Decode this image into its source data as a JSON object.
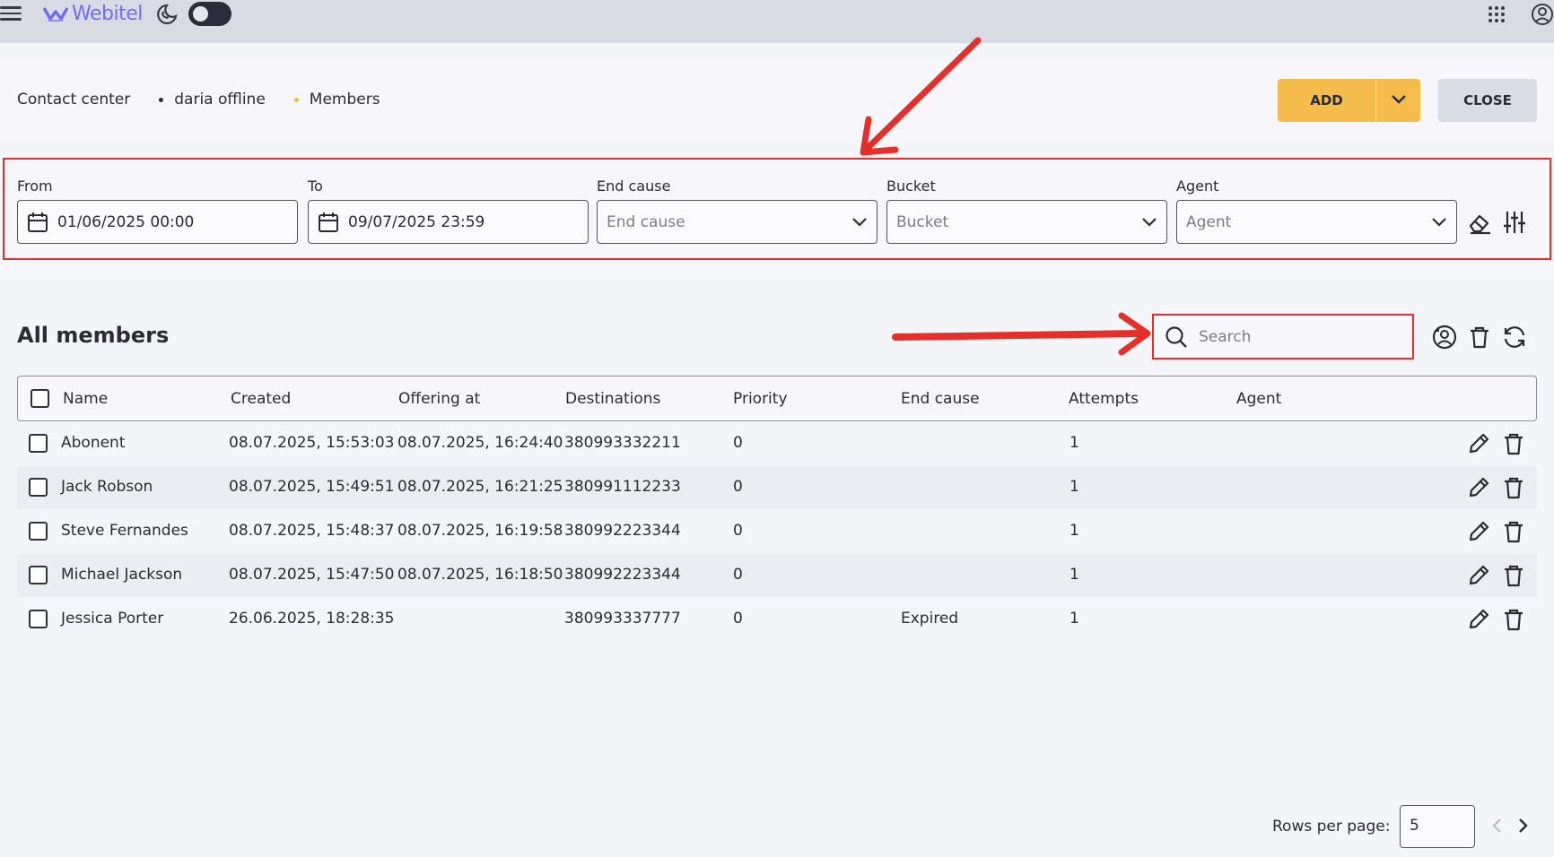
{
  "topbar": {
    "logo_text": "Webitel",
    "icons": [
      "menu-icon",
      "phone-moon-icon",
      "apps-grid-icon",
      "user-account-icon"
    ],
    "toggle_on": false
  },
  "breadcrumb": {
    "items": [
      "Contact center",
      "daria offline",
      "Members"
    ]
  },
  "actions": {
    "add_label": "ADD",
    "close_label": "CLOSE"
  },
  "filters": {
    "from": {
      "label": "From",
      "value": "01/06/2025 00:00"
    },
    "to": {
      "label": "To",
      "value": "09/07/2025 23:59"
    },
    "end_cause": {
      "label": "End cause",
      "placeholder": "End cause"
    },
    "bucket": {
      "label": "Bucket",
      "placeholder": "Bucket"
    },
    "agent": {
      "label": "Agent",
      "placeholder": "Agent"
    }
  },
  "members": {
    "title": "All members",
    "search_placeholder": "Search",
    "columns": [
      "Name",
      "Created",
      "Offering at",
      "Destinations",
      "Priority",
      "End cause",
      "Attempts",
      "Agent"
    ],
    "rows": [
      {
        "name": "Abonent",
        "created": "08.07.2025, 15:53:03",
        "offering_at": "08.07.2025, 16:24:40",
        "destinations": "380993332211",
        "priority": "0",
        "end_cause": "",
        "attempts": "1",
        "agent": ""
      },
      {
        "name": "Jack Robson",
        "created": "08.07.2025, 15:49:51",
        "offering_at": "08.07.2025, 16:21:25",
        "destinations": "380991112233",
        "priority": "0",
        "end_cause": "",
        "attempts": "1",
        "agent": ""
      },
      {
        "name": "Steve Fernandes",
        "created": "08.07.2025, 15:48:37",
        "offering_at": "08.07.2025, 16:19:58",
        "destinations": "380992223344",
        "priority": "0",
        "end_cause": "",
        "attempts": "1",
        "agent": ""
      },
      {
        "name": "Michael Jackson",
        "created": "08.07.2025, 15:47:50",
        "offering_at": "08.07.2025, 16:18:50",
        "destinations": "380992223344",
        "priority": "0",
        "end_cause": "",
        "attempts": "1",
        "agent": ""
      },
      {
        "name": "Jessica Porter",
        "created": "26.06.2025, 18:28:35",
        "offering_at": "",
        "destinations": "380993337777",
        "priority": "0",
        "end_cause": "Expired",
        "attempts": "1",
        "agent": ""
      }
    ]
  },
  "pagination": {
    "rows_per_page_label": "Rows per page:",
    "rows_per_page": "5"
  },
  "colors": {
    "accent": "#f4bb4d",
    "annotation": "#e4302a",
    "logo": "#6d6ef0"
  }
}
